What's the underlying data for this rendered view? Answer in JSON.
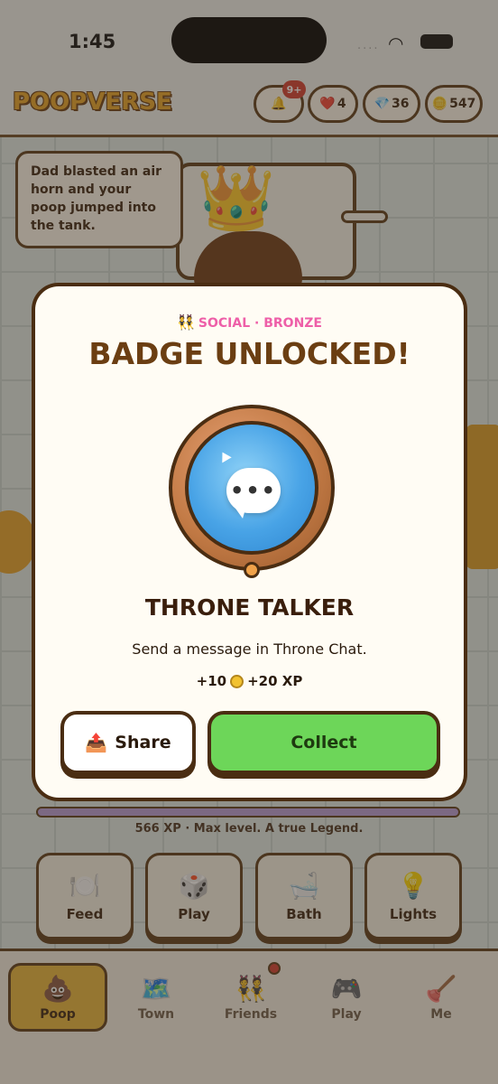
{
  "status_bar": {
    "time": "1:45",
    "signal": "....",
    "wifi_icon": "wifi-icon",
    "battery_icon": "battery-icon"
  },
  "header": {
    "logo": "POOPVERSE",
    "bell_badge": "9+",
    "hearts": "4",
    "gems": "36",
    "coins": "547",
    "bell_icon": "🔔",
    "heart_icon": "❤️",
    "gem_icon": "💎",
    "coin_icon": "🪙"
  },
  "scene": {
    "speech": "Dad blasted an air horn and your poop jumped into the tank.",
    "crown_icon": "👑",
    "xp_text": "566 XP · Max level. A true Legend."
  },
  "actions": [
    {
      "label": "Feed",
      "icon": "🍽️"
    },
    {
      "label": "Play",
      "icon": "🎲"
    },
    {
      "label": "Bath",
      "icon": "🛁"
    },
    {
      "label": "Lights",
      "icon": "💡"
    }
  ],
  "tabs": [
    {
      "label": "Poop",
      "icon": "💩"
    },
    {
      "label": "Town",
      "icon": "🗺️"
    },
    {
      "label": "Friends",
      "icon": "👯"
    },
    {
      "label": "Play",
      "icon": "🎮"
    },
    {
      "label": "Me",
      "icon": "🪠"
    }
  ],
  "modal": {
    "category_icon": "👯",
    "category": "SOCIAL · BRONZE",
    "title": "BADGE UNLOCKED!",
    "badge_icon": "speech-bubble-icon",
    "badge_dots": "•••",
    "badge_name": "THRONE TALKER",
    "description": "Send a message in Throne Chat.",
    "reward_coins": "+10",
    "reward_xp": "+20 XP",
    "share_icon": "📤",
    "share_label": "Share",
    "collect_label": "Collect"
  },
  "colors": {
    "accent_pink": "#ee5fa8",
    "collect_green": "#6dd659",
    "brown_outline": "#4a2d12",
    "bronze": "#c27a45",
    "badge_blue": "#48a3e6"
  }
}
